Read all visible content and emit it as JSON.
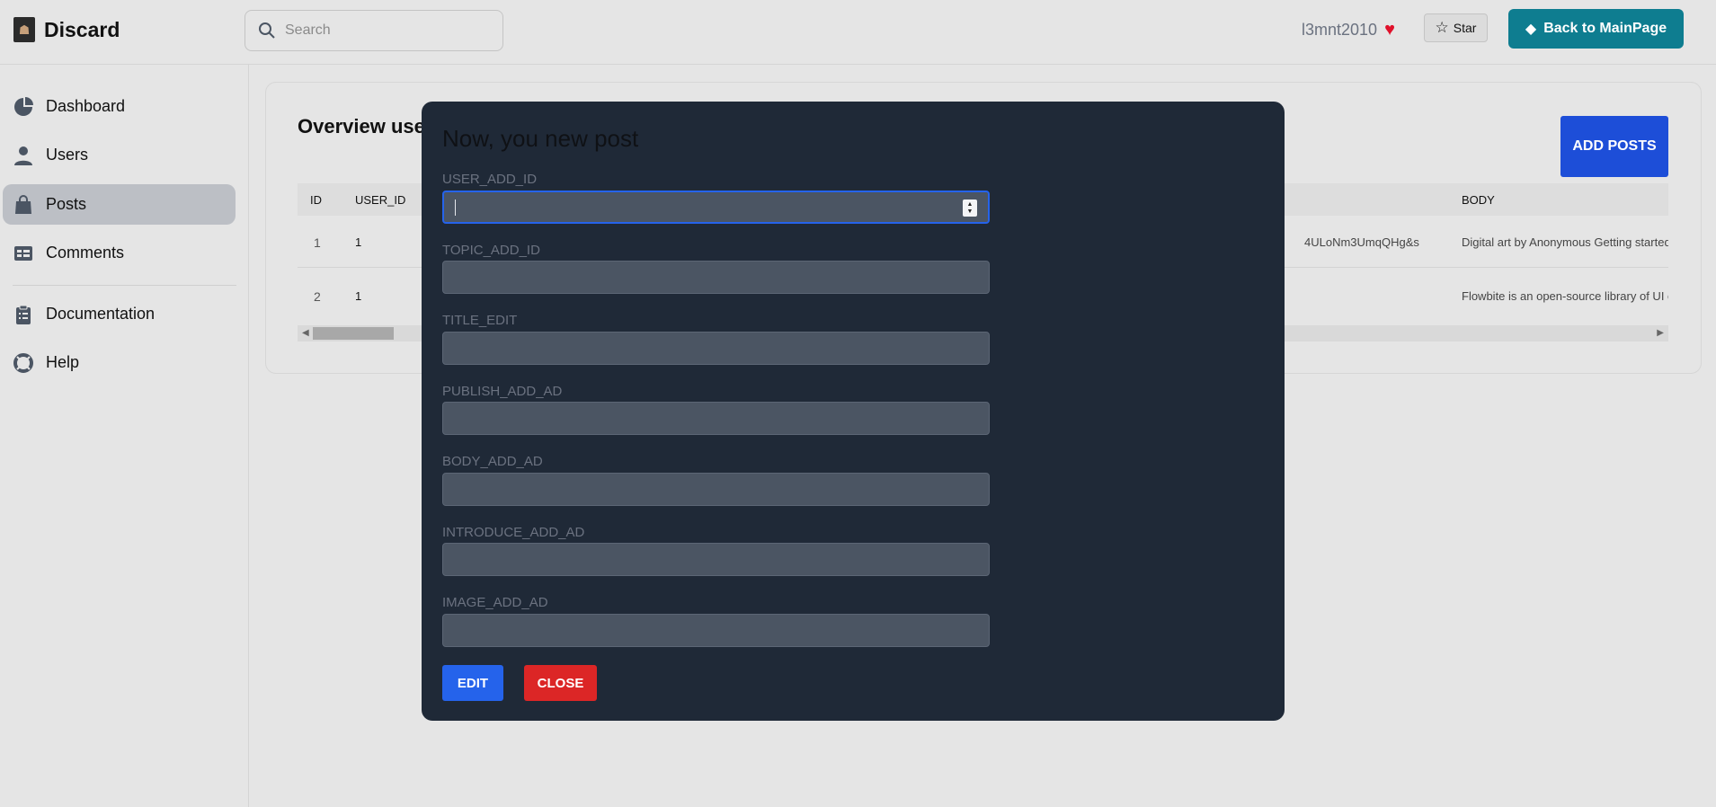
{
  "app": {
    "name": "Discard"
  },
  "search": {
    "placeholder": "Search"
  },
  "header": {
    "username": "l3mnt2010",
    "star_label": "Star",
    "back_label": "Back to MainPage"
  },
  "sidebar": {
    "items": [
      {
        "label": "Dashboard",
        "icon": "pie-chart-icon"
      },
      {
        "label": "Users",
        "icon": "user-icon"
      },
      {
        "label": "Posts",
        "icon": "shopping-bag-icon",
        "active": true
      },
      {
        "label": "Comments",
        "icon": "table-icon"
      },
      {
        "label": "Documentation",
        "icon": "clipboard-icon"
      },
      {
        "label": "Help",
        "icon": "lifebuoy-icon"
      }
    ]
  },
  "main": {
    "title": "Overview use",
    "add_button": "ADD POSTS",
    "table": {
      "headers": {
        "id": "ID",
        "user_id": "USER_ID",
        "body": "BODY"
      },
      "rows": [
        {
          "id": "1",
          "user_id": "1",
          "image_fragment": "4ULoNm3UmqQHg&s",
          "body": "Digital art by Anonymous Getting started wi"
        },
        {
          "id": "2",
          "user_id": "1",
          "image_fragment": "",
          "body": "Flowbite is an open-source library of UI com"
        }
      ]
    }
  },
  "modal": {
    "title": "Now, you new post",
    "fields": [
      {
        "label": "USER_ADD_ID",
        "value": ""
      },
      {
        "label": "TOPIC_ADD_ID",
        "value": ""
      },
      {
        "label": "TITLE_EDIT",
        "value": ""
      },
      {
        "label": "PUBLISH_ADD_AD",
        "value": ""
      },
      {
        "label": "BODY_ADD_AD",
        "value": ""
      },
      {
        "label": "INTRODUCE_ADD_AD",
        "value": ""
      },
      {
        "label": "IMAGE_ADD_AD",
        "value": ""
      }
    ],
    "edit_label": "EDIT",
    "close_label": "CLOSE"
  },
  "colors": {
    "accent_teal": "#0e7d90",
    "primary_blue": "#1d4ed8",
    "danger_red": "#dc2626",
    "modal_bg": "#1f2937"
  }
}
